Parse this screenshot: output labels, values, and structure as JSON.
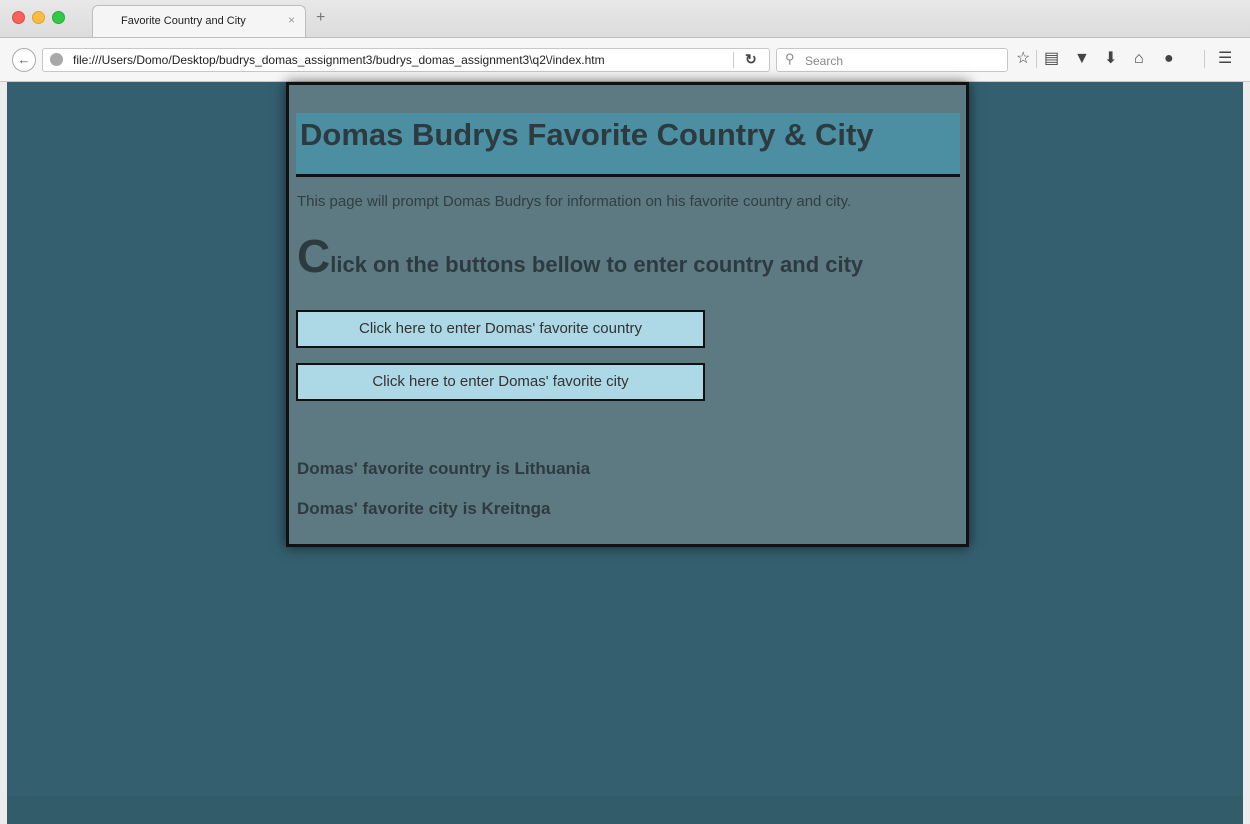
{
  "browser": {
    "tab_title": "Favorite Country and City",
    "tab_close": "×",
    "new_tab": "+",
    "url": "file:///Users/Domo/Desktop/budrys_domas_assignment3/budrys_domas_assignment3\\q2\\/index.htm",
    "search_placeholder": "Search",
    "toolbar_icons": [
      "star-icon",
      "reading-list-icon",
      "pocket-icon",
      "download-icon",
      "home-icon",
      "chat-icon",
      "menu-icon"
    ]
  },
  "page": {
    "heading": "Domas Budrys Favorite Country & City",
    "intro": "This page will prompt Domas Budrys for information on his favorite country and city.",
    "instruction_first_letter": "C",
    "instruction_rest": "lick on the buttons bellow to enter country and city",
    "country_button": "Click here to enter Domas' favorite country",
    "city_button": "Click here to enter Domas' favorite city",
    "country_result": "Domas' favorite country is Lithuania",
    "city_result": "Domas' favorite city is Kreitnga"
  },
  "colors": {
    "viewport_bg": "#345f6f",
    "card_bg": "#5d7a82",
    "banner_bg": "#4c8fa3",
    "button_bg": "#add8e6"
  }
}
